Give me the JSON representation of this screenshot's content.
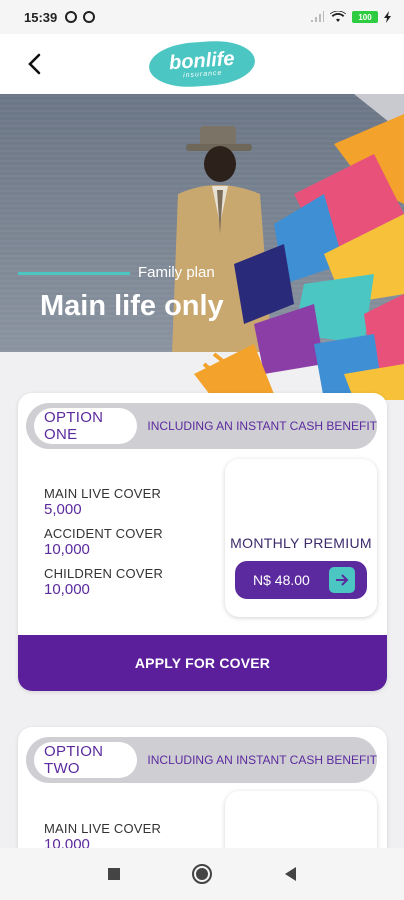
{
  "status": {
    "time": "15:39",
    "battery": "100"
  },
  "header": {
    "logo_main": "bonlife",
    "logo_sub": "insurance"
  },
  "hero": {
    "subtitle": "Family plan",
    "title": "Main life only"
  },
  "options": [
    {
      "label": "OPTION ONE",
      "benefit": "INCLUDING AN INSTANT CASH BENEFIT",
      "covers": [
        {
          "label": "MAIN LIVE COVER",
          "value": "5,000"
        },
        {
          "label": "ACCIDENT COVER",
          "value": "10,000"
        },
        {
          "label": "CHILDREN COVER",
          "value": "10,000"
        }
      ],
      "premium_label": "MONTHLY PREMIUM",
      "premium_value": "N$ 48.00",
      "apply_label": "APPLY FOR COVER"
    },
    {
      "label": "OPTION TWO",
      "benefit": "INCLUDING AN INSTANT CASH BENEFIT",
      "covers": [
        {
          "label": "MAIN LIVE COVER",
          "value": "10,000"
        }
      ]
    }
  ],
  "colors": {
    "purple": "#5b2a9e",
    "teal": "#4cc6c2"
  }
}
